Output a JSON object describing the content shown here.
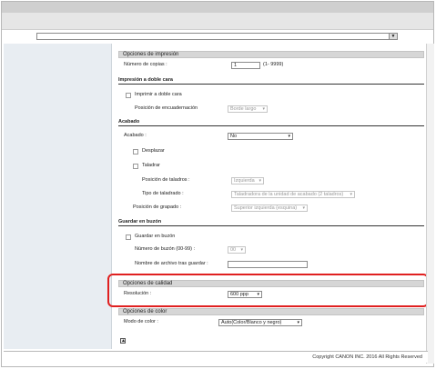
{
  "address": {
    "value": ""
  },
  "sections": {
    "print": {
      "title": "Opciones de impresión",
      "copies_label": "Número de copias :",
      "copies_value": "1",
      "copies_range": "(1- 9999)"
    },
    "duplex": {
      "title": "Impresión a doble cara",
      "checkbox_label": "Imprimir a doble cara",
      "binding_label": "Posición de encuadernación",
      "binding_value": "Borde largo"
    },
    "finishing": {
      "title": "Acabado",
      "finishing_label": "Acabado :",
      "finishing_value": "No",
      "offset_label": "Desplazar",
      "punch_label": "Taladrar",
      "punch_pos_label": "Posición de taladros :",
      "punch_pos_value": "Izquierda",
      "punch_type_label": "Tipo de taladrado :",
      "punch_type_value": "Taladradora de la unidad de acabado (2 taladros)",
      "staple_label": "Posición de grapado :",
      "staple_value": "Superior izquierda (esquina)"
    },
    "mailbox": {
      "title": "Guardar en buzón",
      "save_label": "Guardar en buzón",
      "box_label": "Número de buzón (00-99) :",
      "box_value": "00",
      "filename_label": "Nombre de archivo tras guardar :",
      "filename_value": ""
    },
    "quality": {
      "title": "Opciones de calidad",
      "resolution_label": "Resolución :",
      "resolution_value": "600 ppp"
    },
    "color": {
      "title": "Opciones de color",
      "mode_label": "Modo de color :",
      "mode_value": "Auto(Color/Blanco y negro)"
    }
  },
  "footer": {
    "copyright": "Copyright CANON INC. 2016 All Rights Reserved"
  }
}
